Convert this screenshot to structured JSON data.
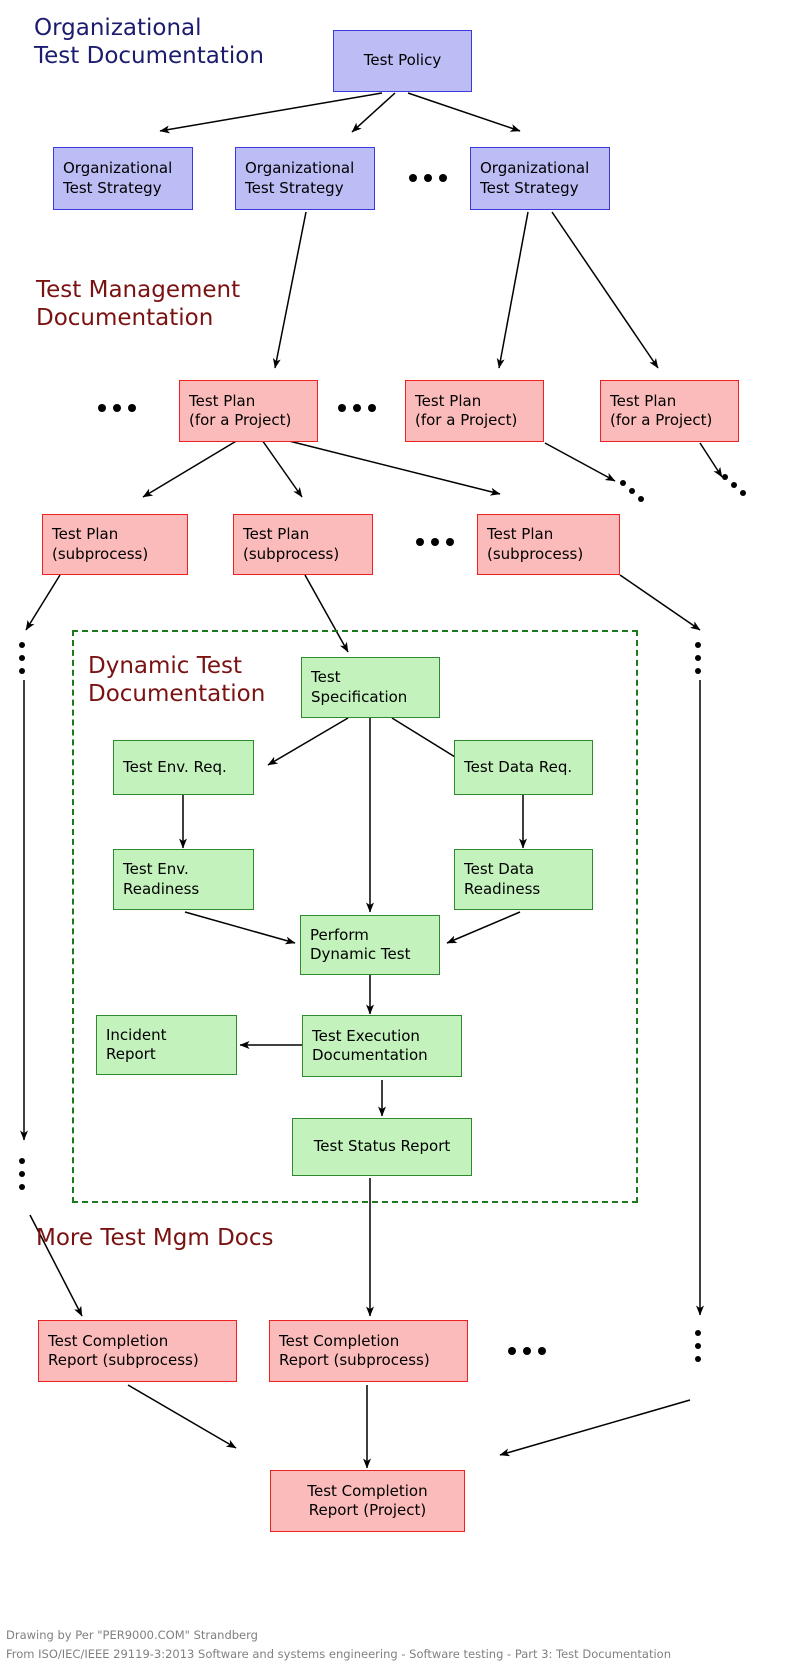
{
  "meta": {
    "title": "ISO/IEC/IEEE 29119-3 Test Documentation Structure"
  },
  "headings": {
    "org": "Organizational\nTest Documentation",
    "mgmt": "Test Management\nDocumentation",
    "dynamic": "Dynamic Test\nDocumentation",
    "more": "More Test Mgm Docs"
  },
  "colors": {
    "blue_fill": "#bdbdf5",
    "blue_stroke": "#3b3bdd",
    "red_fill": "#fcbbbb",
    "red_stroke": "#ef2020",
    "green_fill": "#c3f2bd",
    "green_stroke": "#2f8a2f",
    "heading_navy": "#1c1c6e",
    "heading_maroon": "#7a1212",
    "dashed_group": "#1b7a1b",
    "arrow": "#000000",
    "footer_text": "#808080"
  },
  "nodes": {
    "test_policy": "Test Policy",
    "org_strategy_1": "Organizational\nTest Strategy",
    "org_strategy_2": "Organizational\nTest Strategy",
    "org_strategy_3": "Organizational\nTest Strategy",
    "test_plan_project_1": "Test Plan\n(for a Project)",
    "test_plan_project_2": "Test Plan\n(for a Project)",
    "test_plan_project_3": "Test Plan\n(for a Project)",
    "test_plan_sub_1": "Test Plan\n(subprocess)",
    "test_plan_sub_2": "Test Plan\n(subprocess)",
    "test_plan_sub_3": "Test Plan\n(subprocess)",
    "test_specification": "Test\nSpecification",
    "test_env_req": "Test Env. Req.",
    "test_data_req": "Test Data Req.",
    "test_env_readiness": "Test Env.\nReadiness",
    "test_data_readiness": "Test Data\nReadiness",
    "perform_dynamic_test": "Perform\nDynamic Test",
    "incident_report": "Incident\nReport",
    "test_execution_documentation": "Test Execution\nDocumentation",
    "test_status_report": "Test Status Report",
    "completion_sub_1": "Test Completion\nReport (subprocess)",
    "completion_sub_2": "Test Completion\nReport (subprocess)",
    "completion_project": "Test Completion\nReport (Project)"
  },
  "ellipsis_label": "…",
  "footer": {
    "line1": "Drawing by Per \"PER9000.COM\" Strandberg",
    "line2": "From ISO/IEC/IEEE 29119-3:2013 Software and systems engineering - Software testing - Part 3: Test Documentation"
  }
}
